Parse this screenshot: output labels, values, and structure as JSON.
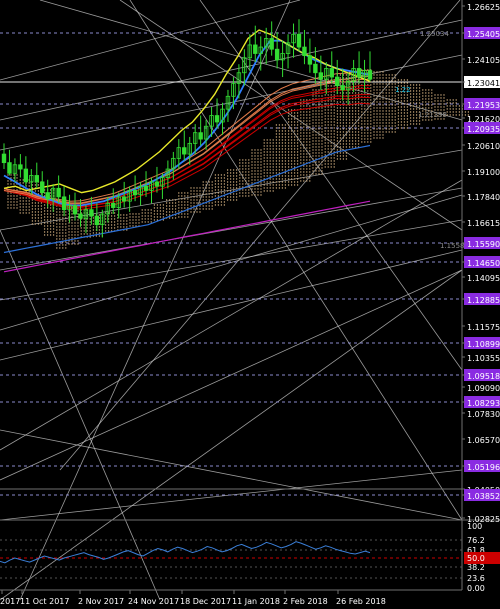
{
  "colors": {
    "background": "#000000",
    "grid": "#6f6f6f",
    "trendline": "#cfcfcf",
    "level_line": "#8a8acb",
    "level_marker_fill": "#8a2be2",
    "candle_up": "#33dd33",
    "price_line": "#e6e6e6",
    "price_badge": "#ffffff",
    "yellow_line": "#e8e82a",
    "blue_line": "#2f7fff",
    "red_bundle": "#cc0000",
    "orange_bundle": "#e07a4a",
    "cloud_dots": "#c9a87a",
    "teal_label": "#22ccee",
    "long_blue": "#2c70d8",
    "long_magenta": "#c020c0",
    "osc_line": "#3a7fd8",
    "osc_level_fill": "#cc0000",
    "tick_text": "#ffffff",
    "small_label": "#8b8b8b"
  },
  "chart_data": {
    "type": "candlestick",
    "instrument_hint": "EURUSD daily",
    "main_panel": {
      "y_axis_ticks": [
        "1.26625",
        "1.25405",
        "1.24105",
        "1.23041",
        "1.21953",
        "1.21620",
        "1.20935",
        "1.20610",
        "1.19100",
        "1.17840",
        "1.16615",
        "1.15590",
        "1.14650",
        "1.14095",
        "1.12885",
        "1.11575",
        "1.10899",
        "1.10355",
        "1.09518",
        "1.09090",
        "1.08293",
        "1.07830",
        "1.06570",
        "1.05196",
        "1.04050",
        "1.03852",
        "1.02825"
      ],
      "highlighted_levels": [
        1.25405,
        1.21953,
        1.20935,
        1.1559,
        1.1465,
        1.12885,
        1.10899,
        1.09518,
        1.08293,
        1.05196,
        1.03852
      ],
      "current_price": 1.23041,
      "price_badge_side_label": "1.23041",
      "in_chart_labels": [
        {
          "text": "1.25034",
          "price": 1.25034
        },
        {
          "text": "1.22"
        },
        {
          "text": "1.21398",
          "price": 1.21398
        },
        {
          "text": "1.1558"
        }
      ],
      "ylim": [
        1.025,
        1.268
      ]
    },
    "x_axis_labels": [
      "2017",
      "11 Oct 2017",
      "2 Nov 2017",
      "24 Nov 2017",
      "18 Dec 2017",
      "11 Jan 2018",
      "2 Feb 2018",
      "26 Feb 2018"
    ],
    "oscillator_panel": {
      "y_axis_ticks": [
        "100",
        "76.2",
        "61.8",
        "50.0",
        "38.2",
        "23.6",
        "0.00"
      ],
      "highlighted_level": "50.0",
      "ylim": [
        0,
        100
      ],
      "series": [
        42,
        40,
        44,
        47,
        45,
        43,
        41,
        44,
        47,
        50,
        48,
        46,
        44,
        47,
        49,
        51,
        53,
        55,
        52,
        50,
        48,
        45,
        47,
        50,
        53,
        56,
        58,
        55,
        52,
        50,
        54,
        58,
        61,
        59,
        56,
        60,
        63,
        61,
        58,
        55,
        57,
        60,
        64,
        62,
        59,
        56,
        58,
        61,
        65,
        67,
        64,
        61,
        63,
        66,
        70,
        68,
        65,
        62,
        64,
        67,
        71,
        69,
        66,
        63,
        60,
        62,
        65,
        63,
        60,
        58,
        56,
        54,
        53,
        55,
        57,
        55
      ]
    },
    "candles": [
      [
        1.196,
        1.201,
        1.189,
        1.192
      ],
      [
        1.192,
        1.198,
        1.186,
        1.187
      ],
      [
        1.187,
        1.194,
        1.183,
        1.191
      ],
      [
        1.191,
        1.196,
        1.185,
        1.189
      ],
      [
        1.189,
        1.195,
        1.181,
        1.183
      ],
      [
        1.183,
        1.189,
        1.177,
        1.186
      ],
      [
        1.186,
        1.192,
        1.18,
        1.183
      ],
      [
        1.183,
        1.188,
        1.176,
        1.178
      ],
      [
        1.178,
        1.184,
        1.171,
        1.175
      ],
      [
        1.175,
        1.182,
        1.169,
        1.18
      ],
      [
        1.18,
        1.186,
        1.173,
        1.176
      ],
      [
        1.176,
        1.181,
        1.167,
        1.17
      ],
      [
        1.17,
        1.177,
        1.164,
        1.172
      ],
      [
        1.172,
        1.178,
        1.165,
        1.168
      ],
      [
        1.168,
        1.175,
        1.162,
        1.166
      ],
      [
        1.166,
        1.172,
        1.159,
        1.17
      ],
      [
        1.17,
        1.176,
        1.163,
        1.167
      ],
      [
        1.167,
        1.173,
        1.16,
        1.163
      ],
      [
        1.163,
        1.17,
        1.157,
        1.168
      ],
      [
        1.168,
        1.176,
        1.164,
        1.173
      ],
      [
        1.173,
        1.18,
        1.168,
        1.171
      ],
      [
        1.171,
        1.178,
        1.166,
        1.176
      ],
      [
        1.176,
        1.183,
        1.171,
        1.174
      ],
      [
        1.174,
        1.181,
        1.169,
        1.179
      ],
      [
        1.179,
        1.186,
        1.174,
        1.177
      ],
      [
        1.177,
        1.183,
        1.172,
        1.181
      ],
      [
        1.181,
        1.188,
        1.176,
        1.179
      ],
      [
        1.179,
        1.185,
        1.173,
        1.183
      ],
      [
        1.183,
        1.19,
        1.178,
        1.181
      ],
      [
        1.181,
        1.187,
        1.175,
        1.185
      ],
      [
        1.185,
        1.193,
        1.18,
        1.189
      ],
      [
        1.189,
        1.197,
        1.184,
        1.194
      ],
      [
        1.194,
        1.203,
        1.189,
        1.199
      ],
      [
        1.199,
        1.207,
        1.193,
        1.196
      ],
      [
        1.196,
        1.204,
        1.191,
        1.201
      ],
      [
        1.201,
        1.21,
        1.196,
        1.206
      ],
      [
        1.206,
        1.214,
        1.2,
        1.203
      ],
      [
        1.203,
        1.212,
        1.198,
        1.209
      ],
      [
        1.209,
        1.218,
        1.204,
        1.214
      ],
      [
        1.214,
        1.222,
        1.208,
        1.211
      ],
      [
        1.211,
        1.22,
        1.205,
        1.217
      ],
      [
        1.217,
        1.226,
        1.211,
        1.223
      ],
      [
        1.223,
        1.232,
        1.217,
        1.229
      ],
      [
        1.229,
        1.238,
        1.222,
        1.234
      ],
      [
        1.234,
        1.245,
        1.228,
        1.241
      ],
      [
        1.241,
        1.252,
        1.235,
        1.247
      ],
      [
        1.247,
        1.256,
        1.239,
        1.243
      ],
      [
        1.243,
        1.251,
        1.235,
        1.246
      ],
      [
        1.246,
        1.255,
        1.238,
        1.25
      ],
      [
        1.25,
        1.258,
        1.242,
        1.245
      ],
      [
        1.245,
        1.253,
        1.236,
        1.24
      ],
      [
        1.24,
        1.249,
        1.232,
        1.243
      ],
      [
        1.243,
        1.252,
        1.236,
        1.248
      ],
      [
        1.248,
        1.257,
        1.241,
        1.252
      ],
      [
        1.252,
        1.259,
        1.244,
        1.246
      ],
      [
        1.246,
        1.254,
        1.238,
        1.242
      ],
      [
        1.242,
        1.25,
        1.234,
        1.238
      ],
      [
        1.238,
        1.246,
        1.229,
        1.234
      ],
      [
        1.234,
        1.242,
        1.226,
        1.231
      ],
      [
        1.231,
        1.239,
        1.224,
        1.236
      ],
      [
        1.236,
        1.244,
        1.229,
        1.232
      ],
      [
        1.232,
        1.24,
        1.224,
        1.228
      ],
      [
        1.228,
        1.236,
        1.221,
        1.226
      ],
      [
        1.226,
        1.234,
        1.219,
        1.23
      ],
      [
        1.23,
        1.24,
        1.225,
        1.236
      ],
      [
        1.236,
        1.244,
        1.229,
        1.232
      ],
      [
        1.232,
        1.24,
        1.225,
        1.235
      ],
      [
        1.235,
        1.244,
        1.23,
        1.231
      ]
    ],
    "moving_averages": {
      "yellow": [
        1.18,
        1.181,
        1.179,
        1.18,
        1.181,
        1.182,
        1.18,
        1.178,
        1.179,
        1.181,
        1.183,
        1.186,
        1.189,
        1.193,
        1.197,
        1.202,
        1.207,
        1.211,
        1.217,
        1.224,
        1.233,
        1.241,
        1.25,
        1.254,
        1.252,
        1.249,
        1.246,
        1.243,
        1.241,
        1.238,
        1.236,
        1.234,
        1.232,
        1.23
      ],
      "blue": [
        1.186,
        1.183,
        1.18,
        1.177,
        1.175,
        1.173,
        1.172,
        1.172,
        1.173,
        1.174,
        1.176,
        1.178,
        1.18,
        1.182,
        1.185,
        1.188,
        1.192,
        1.196,
        1.201,
        1.207,
        1.214,
        1.222,
        1.232,
        1.242,
        1.249,
        1.249,
        1.246,
        1.243,
        1.24,
        1.238,
        1.236,
        1.235,
        1.234,
        1.233
      ],
      "red": [
        1.179,
        1.178,
        1.177,
        1.175,
        1.174,
        1.173,
        1.172,
        1.172,
        1.173,
        1.174,
        1.175,
        1.177,
        1.179,
        1.181,
        1.183,
        1.185,
        1.188,
        1.191,
        1.194,
        1.198,
        1.202,
        1.206,
        1.21,
        1.214,
        1.218,
        1.221,
        1.223,
        1.224,
        1.225,
        1.226,
        1.227,
        1.227,
        1.228,
        1.228
      ],
      "long_blue": [
        1.15,
        1.151,
        1.152,
        1.153,
        1.154,
        1.155,
        1.156,
        1.157,
        1.158,
        1.159,
        1.16,
        1.161,
        1.162,
        1.163,
        1.165,
        1.167,
        1.169,
        1.171,
        1.173,
        1.175,
        1.177,
        1.179,
        1.181,
        1.183,
        1.185,
        1.187,
        1.189,
        1.191,
        1.193,
        1.195,
        1.197,
        1.198,
        1.199,
        1.2
      ],
      "magenta": [
        1.141,
        1.142,
        1.143,
        1.144,
        1.145,
        1.146,
        1.147,
        1.148,
        1.149,
        1.15,
        1.151,
        1.152,
        1.153,
        1.154,
        1.155,
        1.156,
        1.157,
        1.158,
        1.159,
        1.16,
        1.161,
        1.162,
        1.163,
        1.164,
        1.165,
        1.166,
        1.167,
        1.168,
        1.169,
        1.17,
        1.171,
        1.172,
        1.173,
        1.174
      ]
    }
  }
}
